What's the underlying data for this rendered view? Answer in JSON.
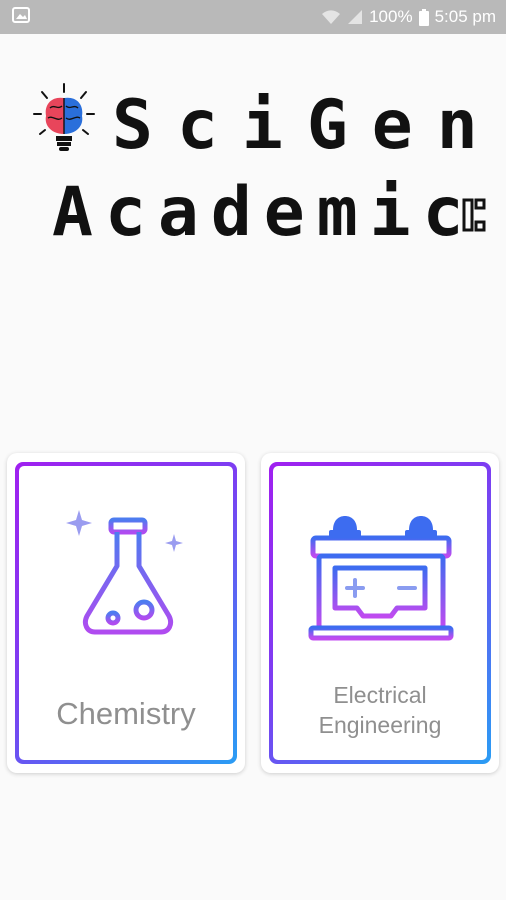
{
  "status_bar": {
    "battery": "100%",
    "time": "5:05 pm",
    "icons": [
      "image-icon",
      "wifi-icon",
      "signal-icon",
      "battery-icon"
    ]
  },
  "logo": {
    "line1": "SciGen",
    "line2": "Academic"
  },
  "cards": {
    "chemistry": {
      "label": "Chemistry",
      "icon": "flask-icon"
    },
    "electrical": {
      "label_line1": "Electrical",
      "label_line2": "Engineering",
      "icon": "battery-icon"
    }
  },
  "colors": {
    "gradient_start": "#a020f0",
    "gradient_end": "#2a9df4",
    "status_bar": "#b9b9b9",
    "brain_left": "#e8455b",
    "brain_right": "#2a6fdb"
  }
}
